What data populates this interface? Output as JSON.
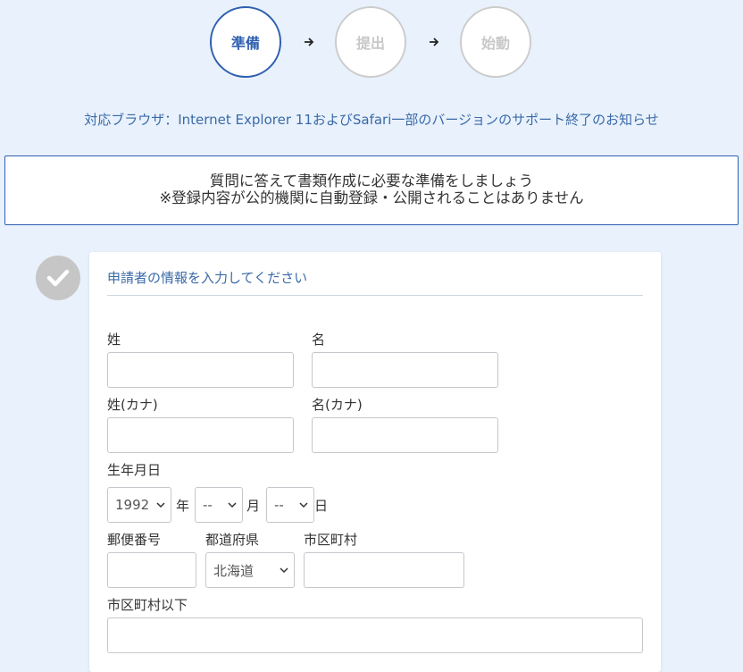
{
  "steps": [
    {
      "label": "準備",
      "state": "active"
    },
    {
      "label": "提出",
      "state": "inactive"
    },
    {
      "label": "始動",
      "state": "inactive"
    }
  ],
  "notice_link": "対応ブラウザ：Internet Explorer 11およびSafari一部のバージョンのサポート終了のお知らせ",
  "info_box": {
    "line1": "質問に答えて書類作成に必要な準備をしましょう",
    "line2": "※登録内容が公的機関に自動登録・公開されることはありません"
  },
  "form": {
    "title": "申請者の情報を入力してください",
    "last_name_label": "姓",
    "first_name_label": "名",
    "last_name_kana_label": "姓(カナ)",
    "first_name_kana_label": "名(カナ)",
    "birthdate_label": "生年月日",
    "birth_year_value": "1992",
    "year_unit": "年",
    "birth_month_value": "--",
    "month_unit": "月",
    "birth_day_value": "--",
    "day_unit": "日",
    "postal_code_label": "郵便番号",
    "prefecture_label": "都道府県",
    "prefecture_value": "北海道",
    "city_label": "市区町村",
    "address_label": "市区町村以下"
  },
  "colors": {
    "background": "#e8f1fc",
    "accent": "#2f5fb0",
    "link": "#3a6aa8",
    "inactive": "#cccccc",
    "check_badge": "#c6c6c6"
  },
  "icons": {
    "arrow": "arrow-right-icon",
    "check": "checkmark-icon",
    "select": "chevron-down-icon"
  }
}
